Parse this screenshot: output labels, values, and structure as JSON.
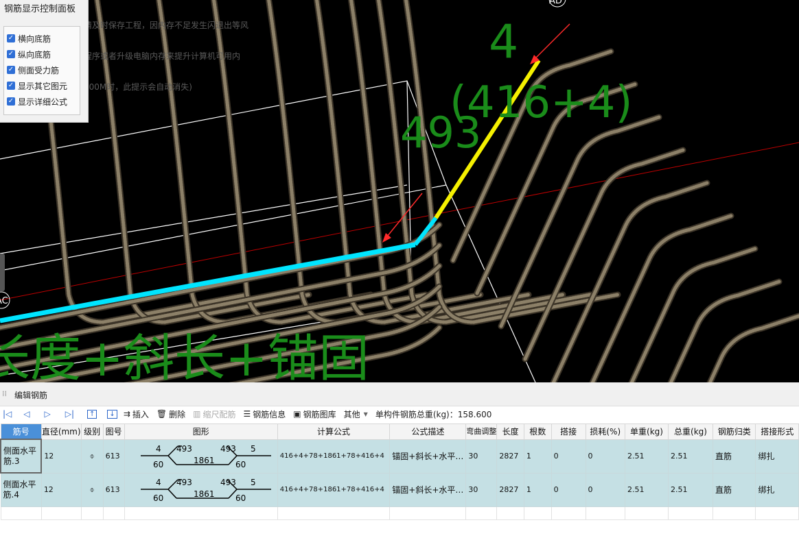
{
  "viewport": {
    "warning_lines": [
      "请及时保存工程，因内存不足发生闪退出等风",
      "程序或者升级电脑内存来提升计算机可用内",
      "200M时，此提示会自动消失)"
    ],
    "label_ad": "AD",
    "label_ac": "AC",
    "big_4": "4",
    "big_formula": "(416+4)",
    "big_493": "493",
    "big_bottom": "长度+斜长+锚固"
  },
  "control_panel": {
    "title": "钢筋显示控制面板",
    "options": [
      {
        "label": "横向底筋",
        "checked": true
      },
      {
        "label": "纵向底筋",
        "checked": true
      },
      {
        "label": "侧面受力筋",
        "checked": true
      },
      {
        "label": "显示其它图元",
        "checked": true
      },
      {
        "label": "显示详细公式",
        "checked": true
      }
    ]
  },
  "edit_panel": {
    "title": "编辑钢筋",
    "toolbar": {
      "insert": "插入",
      "delete": "删除",
      "scale": "缩尺配筋",
      "info": "钢筋信息",
      "library": "钢筋图库",
      "other": "其他",
      "total_label": "单构件钢筋总重(kg)：158.600"
    },
    "columns": [
      "筋号",
      "直径(mm)",
      "级别",
      "图号",
      "图形",
      "计算公式",
      "公式描述",
      "弯曲调整",
      "长度",
      "根数",
      "搭接",
      "损耗(%)",
      "单重(kg)",
      "总重(kg)",
      "钢筋归类",
      "搭接形式"
    ],
    "rows": [
      {
        "name": "侧面水平筋.3",
        "diameter": "12",
        "grade": "⌽",
        "fig": "613",
        "shape": {
          "a": "4",
          "b": "493",
          "c": "493",
          "d": "5",
          "e": "60",
          "f": "1861",
          "g": "60"
        },
        "formula": "416+4+78+1861+78+416+4",
        "desc": "锚固+斜长+水平…",
        "bend": "30",
        "length": "2827",
        "count": "1",
        "lap": "0",
        "loss": "0",
        "unit_w": "2.51",
        "total_w": "2.51",
        "category": "直筋",
        "lap_type": "绑扎"
      },
      {
        "name": "侧面水平筋.4",
        "diameter": "12",
        "grade": "⌽",
        "fig": "613",
        "shape": {
          "a": "4",
          "b": "493",
          "c": "493",
          "d": "5",
          "e": "60",
          "f": "1861",
          "g": "60"
        },
        "formula": "416+4+78+1861+78+416+4",
        "desc": "锚固+斜长+水平…",
        "bend": "30",
        "length": "2827",
        "count": "1",
        "lap": "0",
        "loss": "0",
        "unit_w": "2.51",
        "total_w": "2.51",
        "category": "直筋",
        "lap_type": "绑扎"
      }
    ]
  }
}
